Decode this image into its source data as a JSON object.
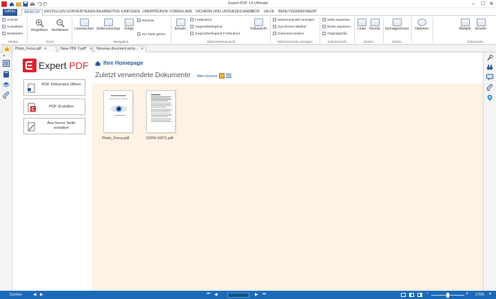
{
  "window": {
    "title": "Expert PDF 14 Ultimate"
  },
  "menu_tabs": [
    "DATEI",
    "ANSICHT",
    "ERSTELLEN",
    "KONVERTIEREN",
    "BEARBEITEN",
    "EINFÜGEN",
    "ÜBERPRÜFEN",
    "FORMULARE",
    "SICHERN UND UNTERZEICHNEN",
    "OCR",
    "HILFE",
    "BENUTZERDEFINIERT"
  ],
  "ribbon": {
    "modus": {
      "items": [
        "Ansicht",
        "Auswählen",
        "Bearbeiten"
      ],
      "group": "Modus"
    },
    "zoom": {
      "zoom_in": "Vergrößern",
      "zoom_out": "Verkleinern",
      "group": "Zoom"
    },
    "navigation": {
      "bookmarks": "Lesezeichen",
      "preview": "Seitenvorschau",
      "previous": "Vorige",
      "next": "Nächste",
      "goto": "Zur Seite gehen",
      "group": "Navigation"
    },
    "docview": {
      "single": "Einzeln",
      "items": [
        "Fortlaufend",
        "Gegenüberliegend",
        "Gegenüberliegend Fortlaufend"
      ],
      "fullscreen": "Vollansicht",
      "group": "Dokumentenansicht"
    },
    "sidebyside": {
      "items": [
        "Nebeneinander anzeigen",
        "Synchroner Bildlauf",
        "Dokument ändern"
      ],
      "group": "Nebeneinander anzeigen"
    },
    "pageview": {
      "items": [
        "Seite anpassen",
        "Breite anpassen",
        "Originalgröße"
      ],
      "group": "Seitenansicht"
    },
    "rotate": {
      "left": "Links",
      "right": "Rechts",
      "group": "Drehen"
    },
    "extras": {
      "snapshot": "Schnappschuss",
      "group": "Extras"
    },
    "options": {
      "label": "Optionen"
    },
    "documents": {
      "multiple": "Multiple",
      "single": "Einzeln",
      "group": "Dokumente"
    }
  },
  "doc_tabs": [
    "Photo_Focus.pdf",
    "Neue PDF 2.pdf*",
    "Nouveau document porta..."
  ],
  "home": {
    "logo_expert": "Expert",
    "logo_pdf": "PDF",
    "breadcrumb": "Ihre Homepage",
    "recent_title": "Zuletzt verwendete Dokumente",
    "clear_all": "Alles löschen",
    "actions": [
      "PDF Dokument öffnen",
      "PDF Erstellen",
      "Aus leerer Seite erstellen"
    ],
    "recent_files": [
      "Photo_Focus.pdf",
      "SCPH-10071.pdf"
    ]
  },
  "status": {
    "search": "Suchen",
    "zoom": "170%"
  },
  "colors": {
    "accent": "#2b5797",
    "logo_red": "#d9232e",
    "statusbar": "#1b6ab8",
    "recent_bg": "#fdf2e4"
  }
}
